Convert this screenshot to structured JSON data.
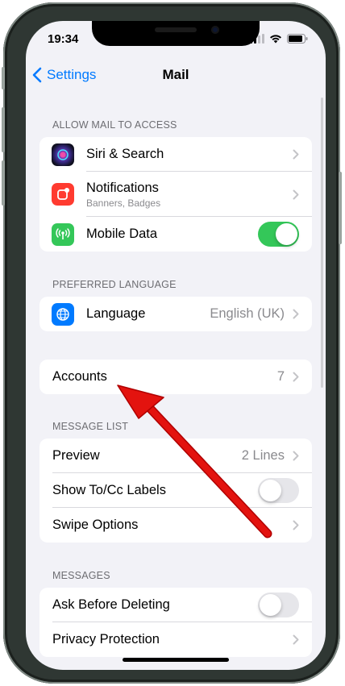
{
  "status_bar": {
    "time": "19:34"
  },
  "nav": {
    "back_label": "Settings",
    "title": "Mail"
  },
  "sections": {
    "allow_access": {
      "header": "ALLOW MAIL TO ACCESS",
      "siri": {
        "label": "Siri & Search"
      },
      "notifications": {
        "label": "Notifications",
        "sub": "Banners, Badges"
      },
      "mobile_data": {
        "label": "Mobile Data",
        "toggle": "on"
      }
    },
    "language": {
      "header": "PREFERRED LANGUAGE",
      "language": {
        "label": "Language",
        "value": "English (UK)"
      }
    },
    "accounts": {
      "label": "Accounts",
      "value": "7"
    },
    "message_list": {
      "header": "MESSAGE LIST",
      "preview": {
        "label": "Preview",
        "value": "2 Lines"
      },
      "show_to_cc": {
        "label": "Show To/Cc Labels",
        "toggle": "off"
      },
      "swipe_options": {
        "label": "Swipe Options"
      }
    },
    "messages": {
      "header": "MESSAGES",
      "ask_before_deleting": {
        "label": "Ask Before Deleting",
        "toggle": "off"
      },
      "privacy_protection": {
        "label": "Privacy Protection"
      }
    }
  },
  "colors": {
    "accent": "#007aff",
    "toggle_on": "#34c759",
    "annotation_arrow": "#e3130f",
    "background": "#f2f2f7"
  },
  "annotation": {
    "type": "arrow",
    "points_to": "Accounts"
  }
}
